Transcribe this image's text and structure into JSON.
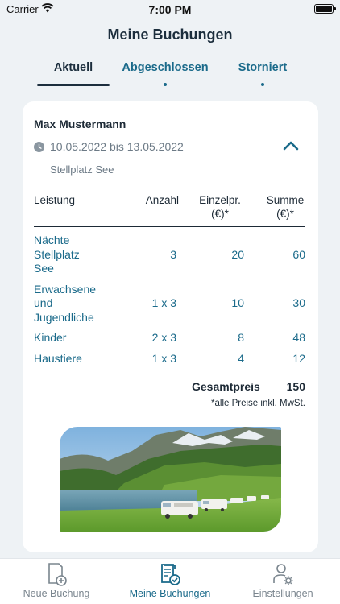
{
  "status_bar": {
    "carrier": "Carrier",
    "time": "7:00 PM"
  },
  "header": {
    "title": "Meine Buchungen"
  },
  "tabs": [
    {
      "label": "Aktuell",
      "active": true
    },
    {
      "label": "Abgeschlossen",
      "active": false
    },
    {
      "label": "Storniert",
      "active": false
    }
  ],
  "booking": {
    "guest": "Max Mustermann",
    "date_range": "10.05.2022 bis 13.05.2022",
    "pitch": "Stellplatz See",
    "table": {
      "headers": {
        "service": "Leistung",
        "quantity": "Anzahl",
        "unit_price_line1": "Einzelpr.",
        "unit_price_line2": "(€)*",
        "sum_line1": "Summe",
        "sum_line2": "(€)*"
      },
      "rows": [
        {
          "service_lines": [
            "Nächte",
            "Stellplatz",
            "See"
          ],
          "quantity": "3",
          "unit_price": "20",
          "sum": "60"
        },
        {
          "service_lines": [
            "Erwachsene",
            "und",
            "Jugendliche"
          ],
          "quantity": "1 x 3",
          "unit_price": "10",
          "sum": "30"
        },
        {
          "service_lines": [
            "Kinder"
          ],
          "quantity": "2 x 3",
          "unit_price": "8",
          "sum": "48"
        },
        {
          "service_lines": [
            "Haustiere"
          ],
          "quantity": "1 x 3",
          "unit_price": "4",
          "sum": "12"
        }
      ]
    },
    "total_label": "Gesamtpreis",
    "total_value": "150",
    "vat_note": "*alle Preise inkl. MwSt."
  },
  "tabbar": {
    "items": [
      {
        "label": "Neue Buchung",
        "icon": "new-booking-icon",
        "active": false
      },
      {
        "label": "Meine Buchungen",
        "icon": "bookings-icon",
        "active": true
      },
      {
        "label": "Einstellungen",
        "icon": "settings-person-icon",
        "active": false
      }
    ]
  },
  "colors": {
    "accent": "#1a6a8a",
    "title": "#1c2e3d",
    "background": "#eef2f5",
    "muted": "#6c7a86"
  }
}
